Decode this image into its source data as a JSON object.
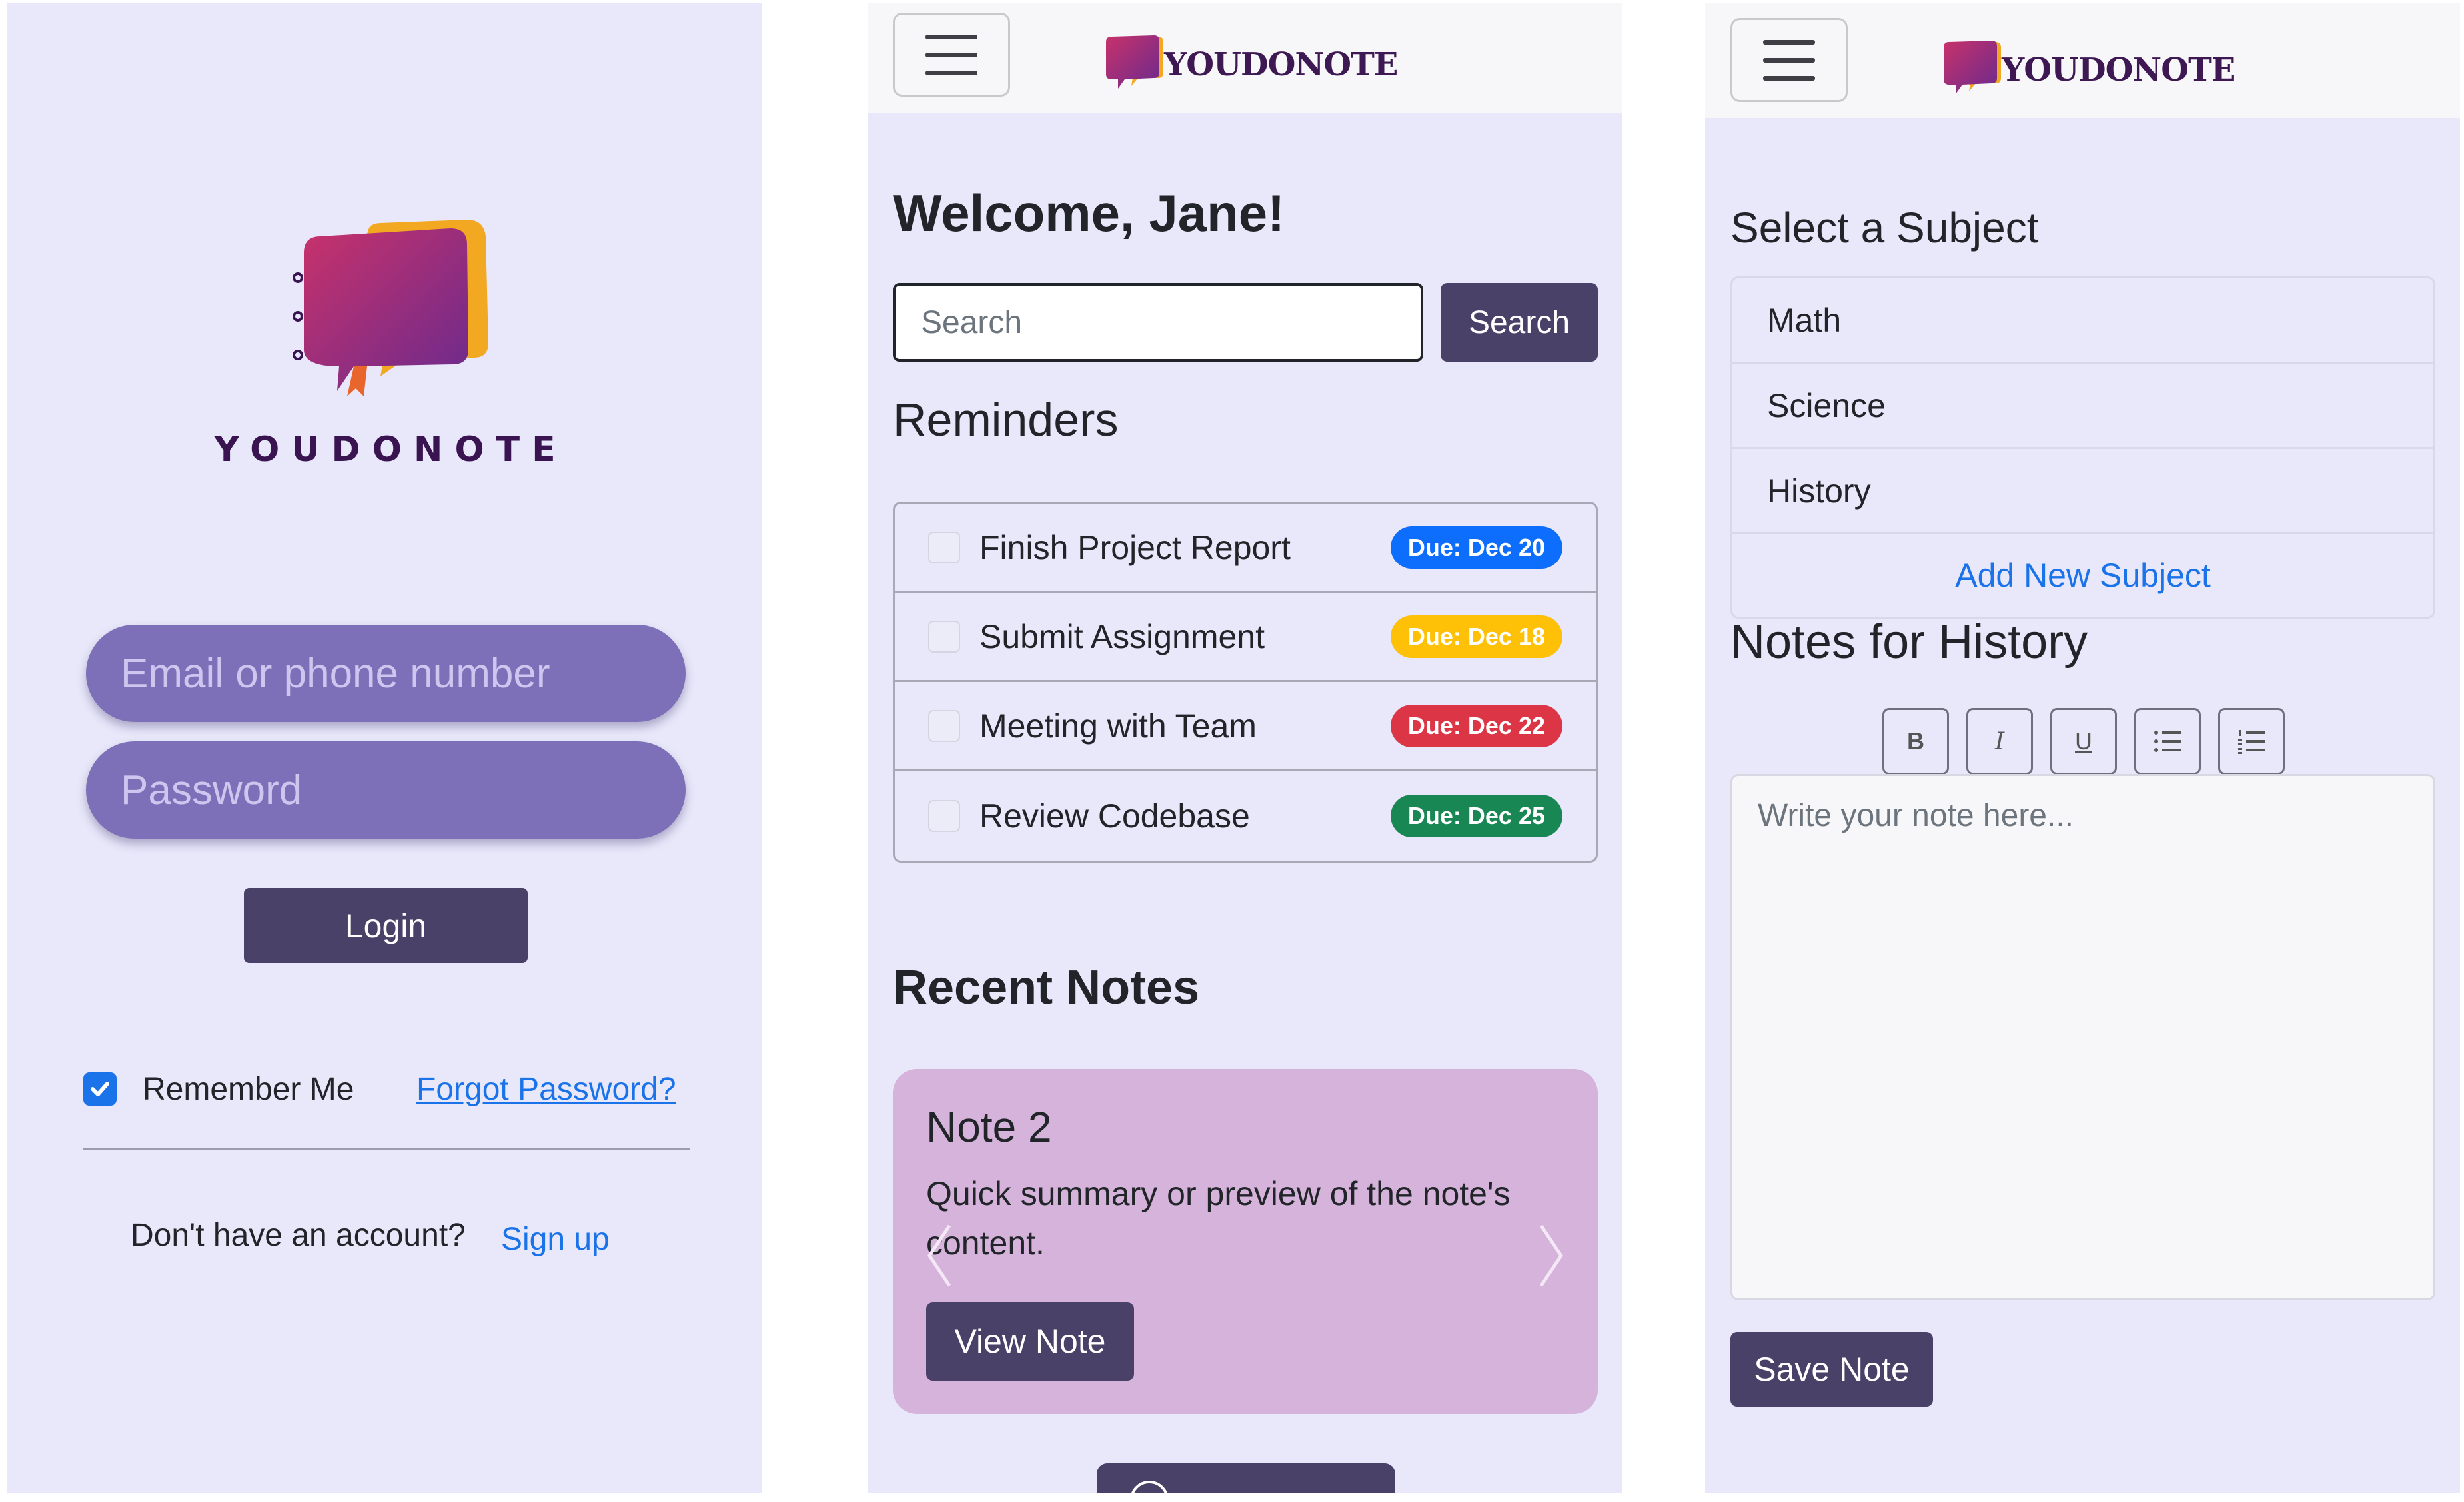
{
  "login": {
    "brand": "YOUDONOTE",
    "email_placeholder": "Email or phone number",
    "password_placeholder": "Password",
    "login_label": "Login",
    "remember_label": "Remember Me",
    "remember_checked": true,
    "forgot_label": "Forgot Password?",
    "no_account_text": "Don't have an account?",
    "signup_label": "Sign up"
  },
  "navbar": {
    "brand": "YOUDONOTE",
    "menu_icon": "hamburger-menu-icon"
  },
  "dashboard": {
    "welcome": "Welcome, Jane!",
    "search_placeholder": "Search",
    "search_button": "Search",
    "reminders_heading": "Reminders",
    "reminders": [
      {
        "title": "Finish Project Report",
        "due": "Due: Dec 20",
        "color": "#0d6efd",
        "text_color": "#ffffff"
      },
      {
        "title": "Submit Assignment",
        "due": "Due: Dec 18",
        "color": "#ffc107",
        "text_color": "#ffffff"
      },
      {
        "title": "Meeting with Team",
        "due": "Due: Dec 22",
        "color": "#dc3545",
        "text_color": "#ffffff"
      },
      {
        "title": "Review Codebase",
        "due": "Due: Dec 25",
        "color": "#198754",
        "text_color": "#ffffff"
      }
    ],
    "recent_notes_heading": "Recent Notes",
    "note": {
      "title": "Note 2",
      "summary": "Quick summary or preview of the note's content.",
      "view_button": "View Note"
    }
  },
  "notes_editor": {
    "select_heading": "Select a Subject",
    "subjects": [
      "Math",
      "Science",
      "History"
    ],
    "add_subject": "Add New Subject",
    "notes_heading": "Notes for History",
    "toolbar": [
      {
        "label": "B",
        "name": "bold-button"
      },
      {
        "label": "I",
        "name": "italic-button"
      },
      {
        "label": "U",
        "name": "underline-button"
      }
    ],
    "editor_placeholder": "Write your note here...",
    "save_button": "Save Note"
  },
  "colors": {
    "panel_bg": "#e8e8fa",
    "primary_button": "#4a4168",
    "input_pill": "#7d70b8",
    "note_card": "#d5b3da",
    "link": "#1a73e8"
  }
}
